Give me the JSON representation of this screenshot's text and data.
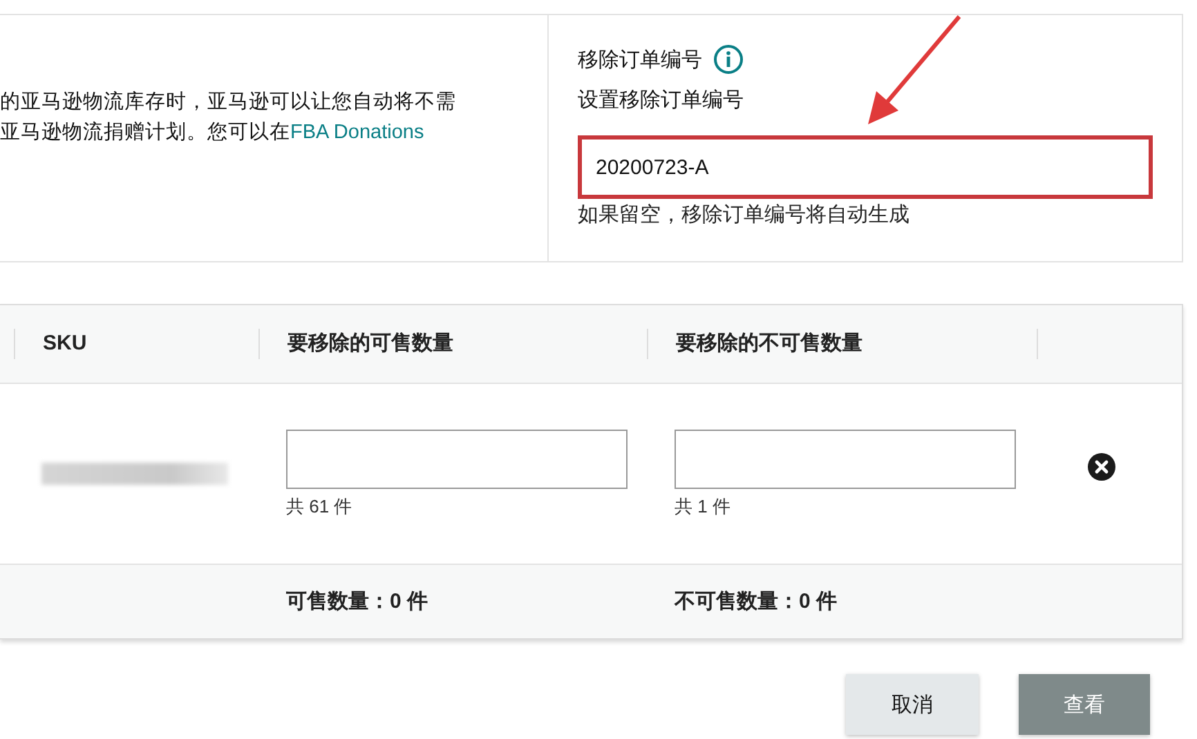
{
  "description": {
    "lines": [
      "的亚马逊物流库存时，亚马逊可以让您自动将不需",
      "亚马逊物流捐赠计划。您可以在"
    ],
    "link": "FBA Donations"
  },
  "order_id": {
    "title": "移除订单编号",
    "label": "设置移除订单编号",
    "value": "20200723-A",
    "hint": "如果留空，移除订单编号将自动生成"
  },
  "table": {
    "columns": [
      "SKU",
      "要移除的可售数量",
      "要移除的不可售数量"
    ],
    "rows": [
      {
        "sellable_total": "共 61 件",
        "unsellable_total": "共 1 件"
      }
    ],
    "footer": [
      "可售数量：0 件",
      "不可售数量：0 件"
    ]
  },
  "buttons": [
    {
      "label": "取消",
      "kind": "secondary"
    },
    {
      "label": "查看",
      "kind": "primary"
    }
  ]
}
